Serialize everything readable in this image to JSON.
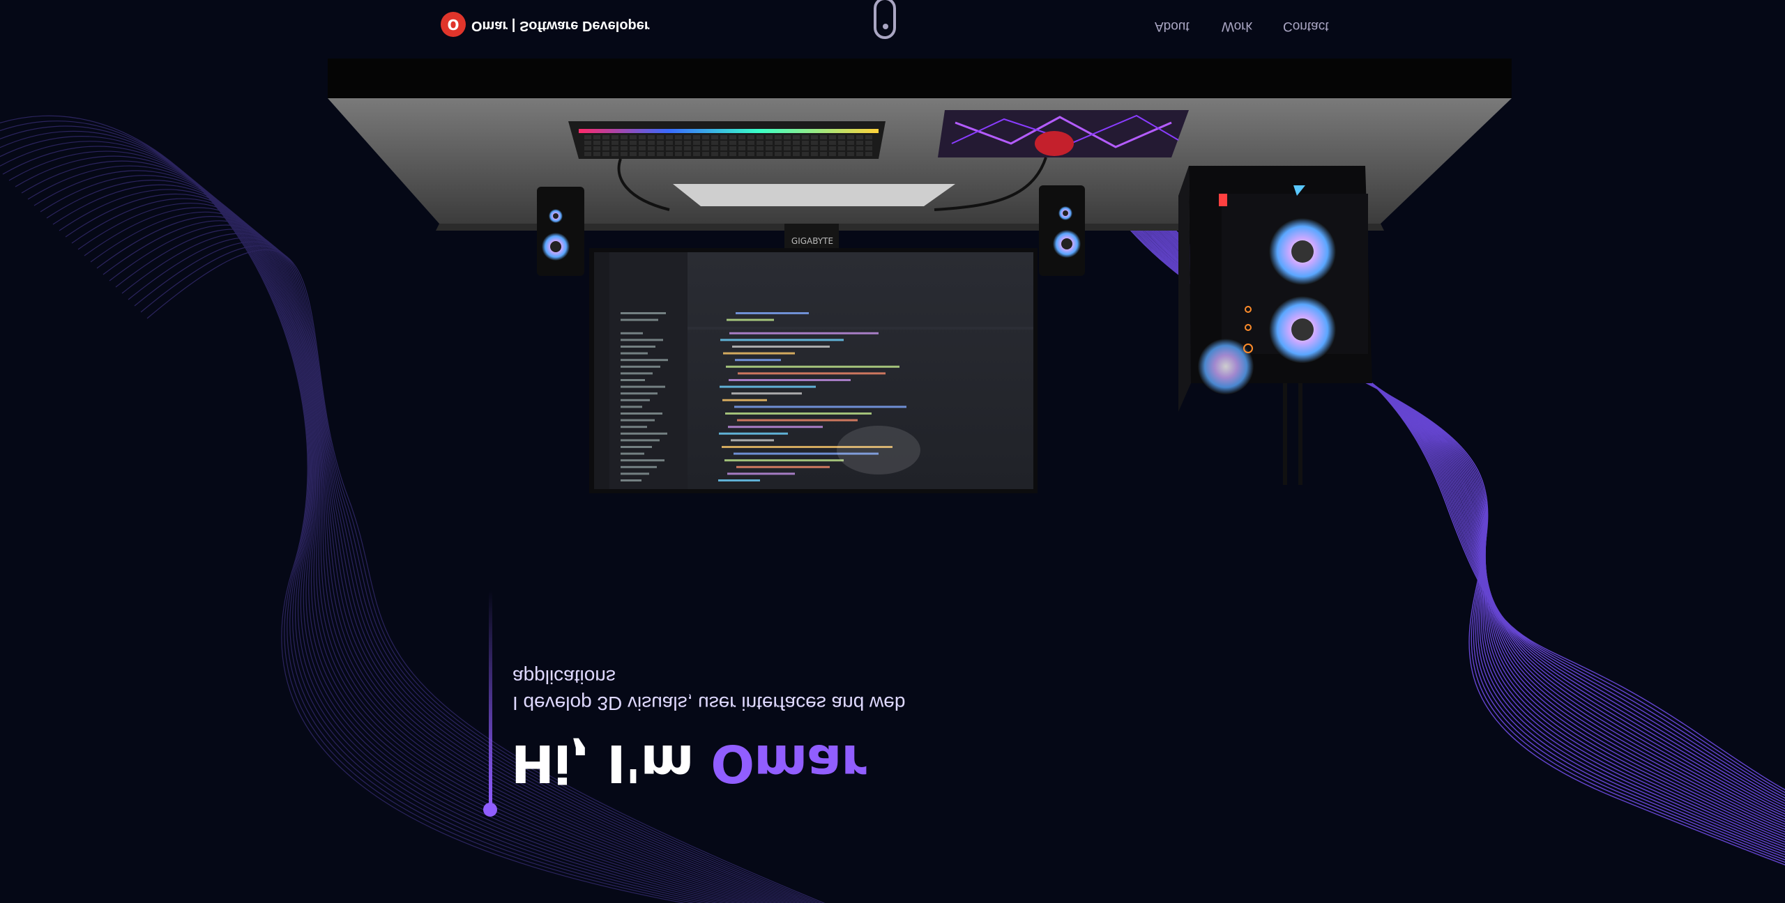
{
  "hero": {
    "greeting": "Hi, I'm ",
    "name": "Omar",
    "subtitle": "I develop 3D visuals, user interfaces and web applications"
  },
  "navbar": {
    "logo_letter": "O",
    "brand": "Omar | Software Developer",
    "links": [
      "About",
      "Work",
      "Contact"
    ]
  },
  "scene": {
    "monitor_brand": "GIGABYTE"
  },
  "colors": {
    "background": "#050816",
    "accent": "#915eff",
    "logo": "#e0352b"
  }
}
